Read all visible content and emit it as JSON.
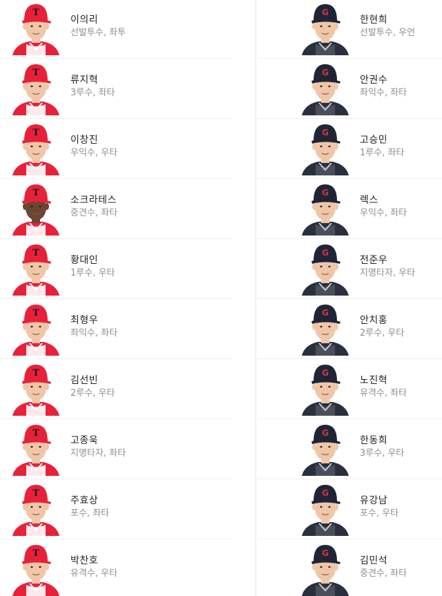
{
  "colors": {
    "home_cap": "#e8213a",
    "home_cap_logo": "#1a1a1a",
    "home_jersey": "#e8213a",
    "away_cap": "#1f2536",
    "away_cap_logo": "#d2353c",
    "away_jersey": "#2a2f3e",
    "skin_light": "#efc7a8",
    "skin_dark": "#6b4632",
    "name_text": "#222222",
    "meta_text": "#8e8e8e"
  },
  "home_team": {
    "cap_logo_icon": "tigers-t-logo-icon",
    "players": [
      {
        "name": "이의리",
        "position": "선발투수",
        "hand": "좌투"
      },
      {
        "name": "류지혁",
        "position": "3루수",
        "hand": "좌타"
      },
      {
        "name": "이창진",
        "position": "우익수",
        "hand": "우타"
      },
      {
        "name": "소크라테스",
        "position": "중견수",
        "hand": "좌타"
      },
      {
        "name": "황대인",
        "position": "1루수",
        "hand": "우타"
      },
      {
        "name": "최형우",
        "position": "좌익수",
        "hand": "좌타"
      },
      {
        "name": "김선빈",
        "position": "2루수",
        "hand": "우타"
      },
      {
        "name": "고종욱",
        "position": "지명타자",
        "hand": "좌타"
      },
      {
        "name": "주효상",
        "position": "포수",
        "hand": "좌타"
      },
      {
        "name": "박찬호",
        "position": "유격수",
        "hand": "우타"
      }
    ]
  },
  "away_team": {
    "cap_logo_icon": "lotte-giants-g-logo-icon",
    "players": [
      {
        "name": "한현희",
        "position": "선발투수",
        "hand": "우언"
      },
      {
        "name": "안권수",
        "position": "좌익수",
        "hand": "좌타"
      },
      {
        "name": "고승민",
        "position": "1루수",
        "hand": "좌타"
      },
      {
        "name": "렉스",
        "position": "우익수",
        "hand": "좌타"
      },
      {
        "name": "전준우",
        "position": "지명타자",
        "hand": "우타"
      },
      {
        "name": "안치홍",
        "position": "2루수",
        "hand": "우타"
      },
      {
        "name": "노진혁",
        "position": "유격수",
        "hand": "좌타"
      },
      {
        "name": "한동희",
        "position": "3루수",
        "hand": "우타"
      },
      {
        "name": "유강남",
        "position": "포수",
        "hand": "우타"
      },
      {
        "name": "김민석",
        "position": "중견수",
        "hand": "좌타"
      }
    ]
  }
}
